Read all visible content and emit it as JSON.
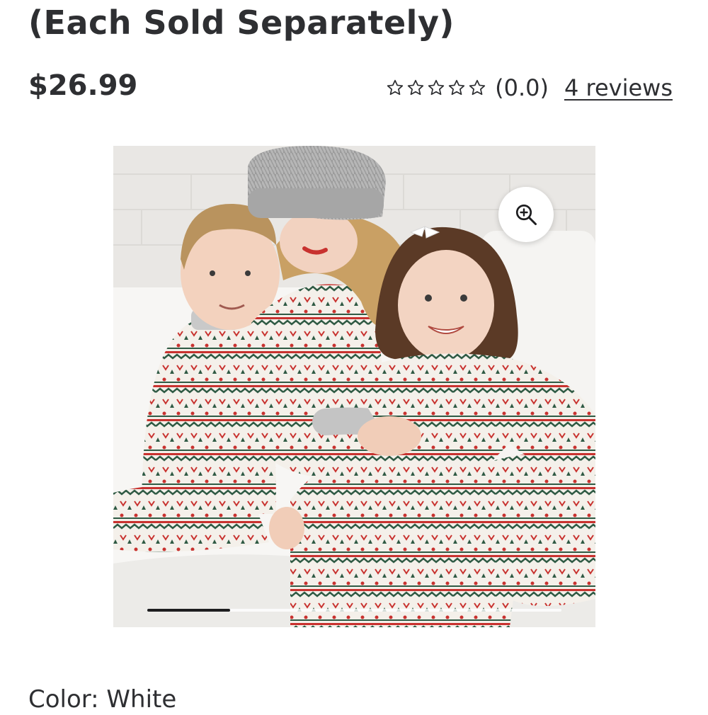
{
  "product": {
    "title": "(Each Sold Separately)",
    "price": "$26.99",
    "rating": {
      "stars_filled": 0,
      "stars_total": 5,
      "value_text": "(0.0)",
      "reviews_link": "4 reviews"
    }
  },
  "gallery": {
    "image_description_icon": "family-christmas-pajamas-photo",
    "zoom_icon": "zoom-in-icon",
    "carousel_progress": 0.2,
    "image_count_visible": 1
  },
  "variant": {
    "color_label": "Color: White"
  },
  "colors": {
    "text": "#2e2f32",
    "pajama_red": "#c8322f",
    "pajama_green": "#2f5a44",
    "carousel_active": "#1d1d1f"
  }
}
